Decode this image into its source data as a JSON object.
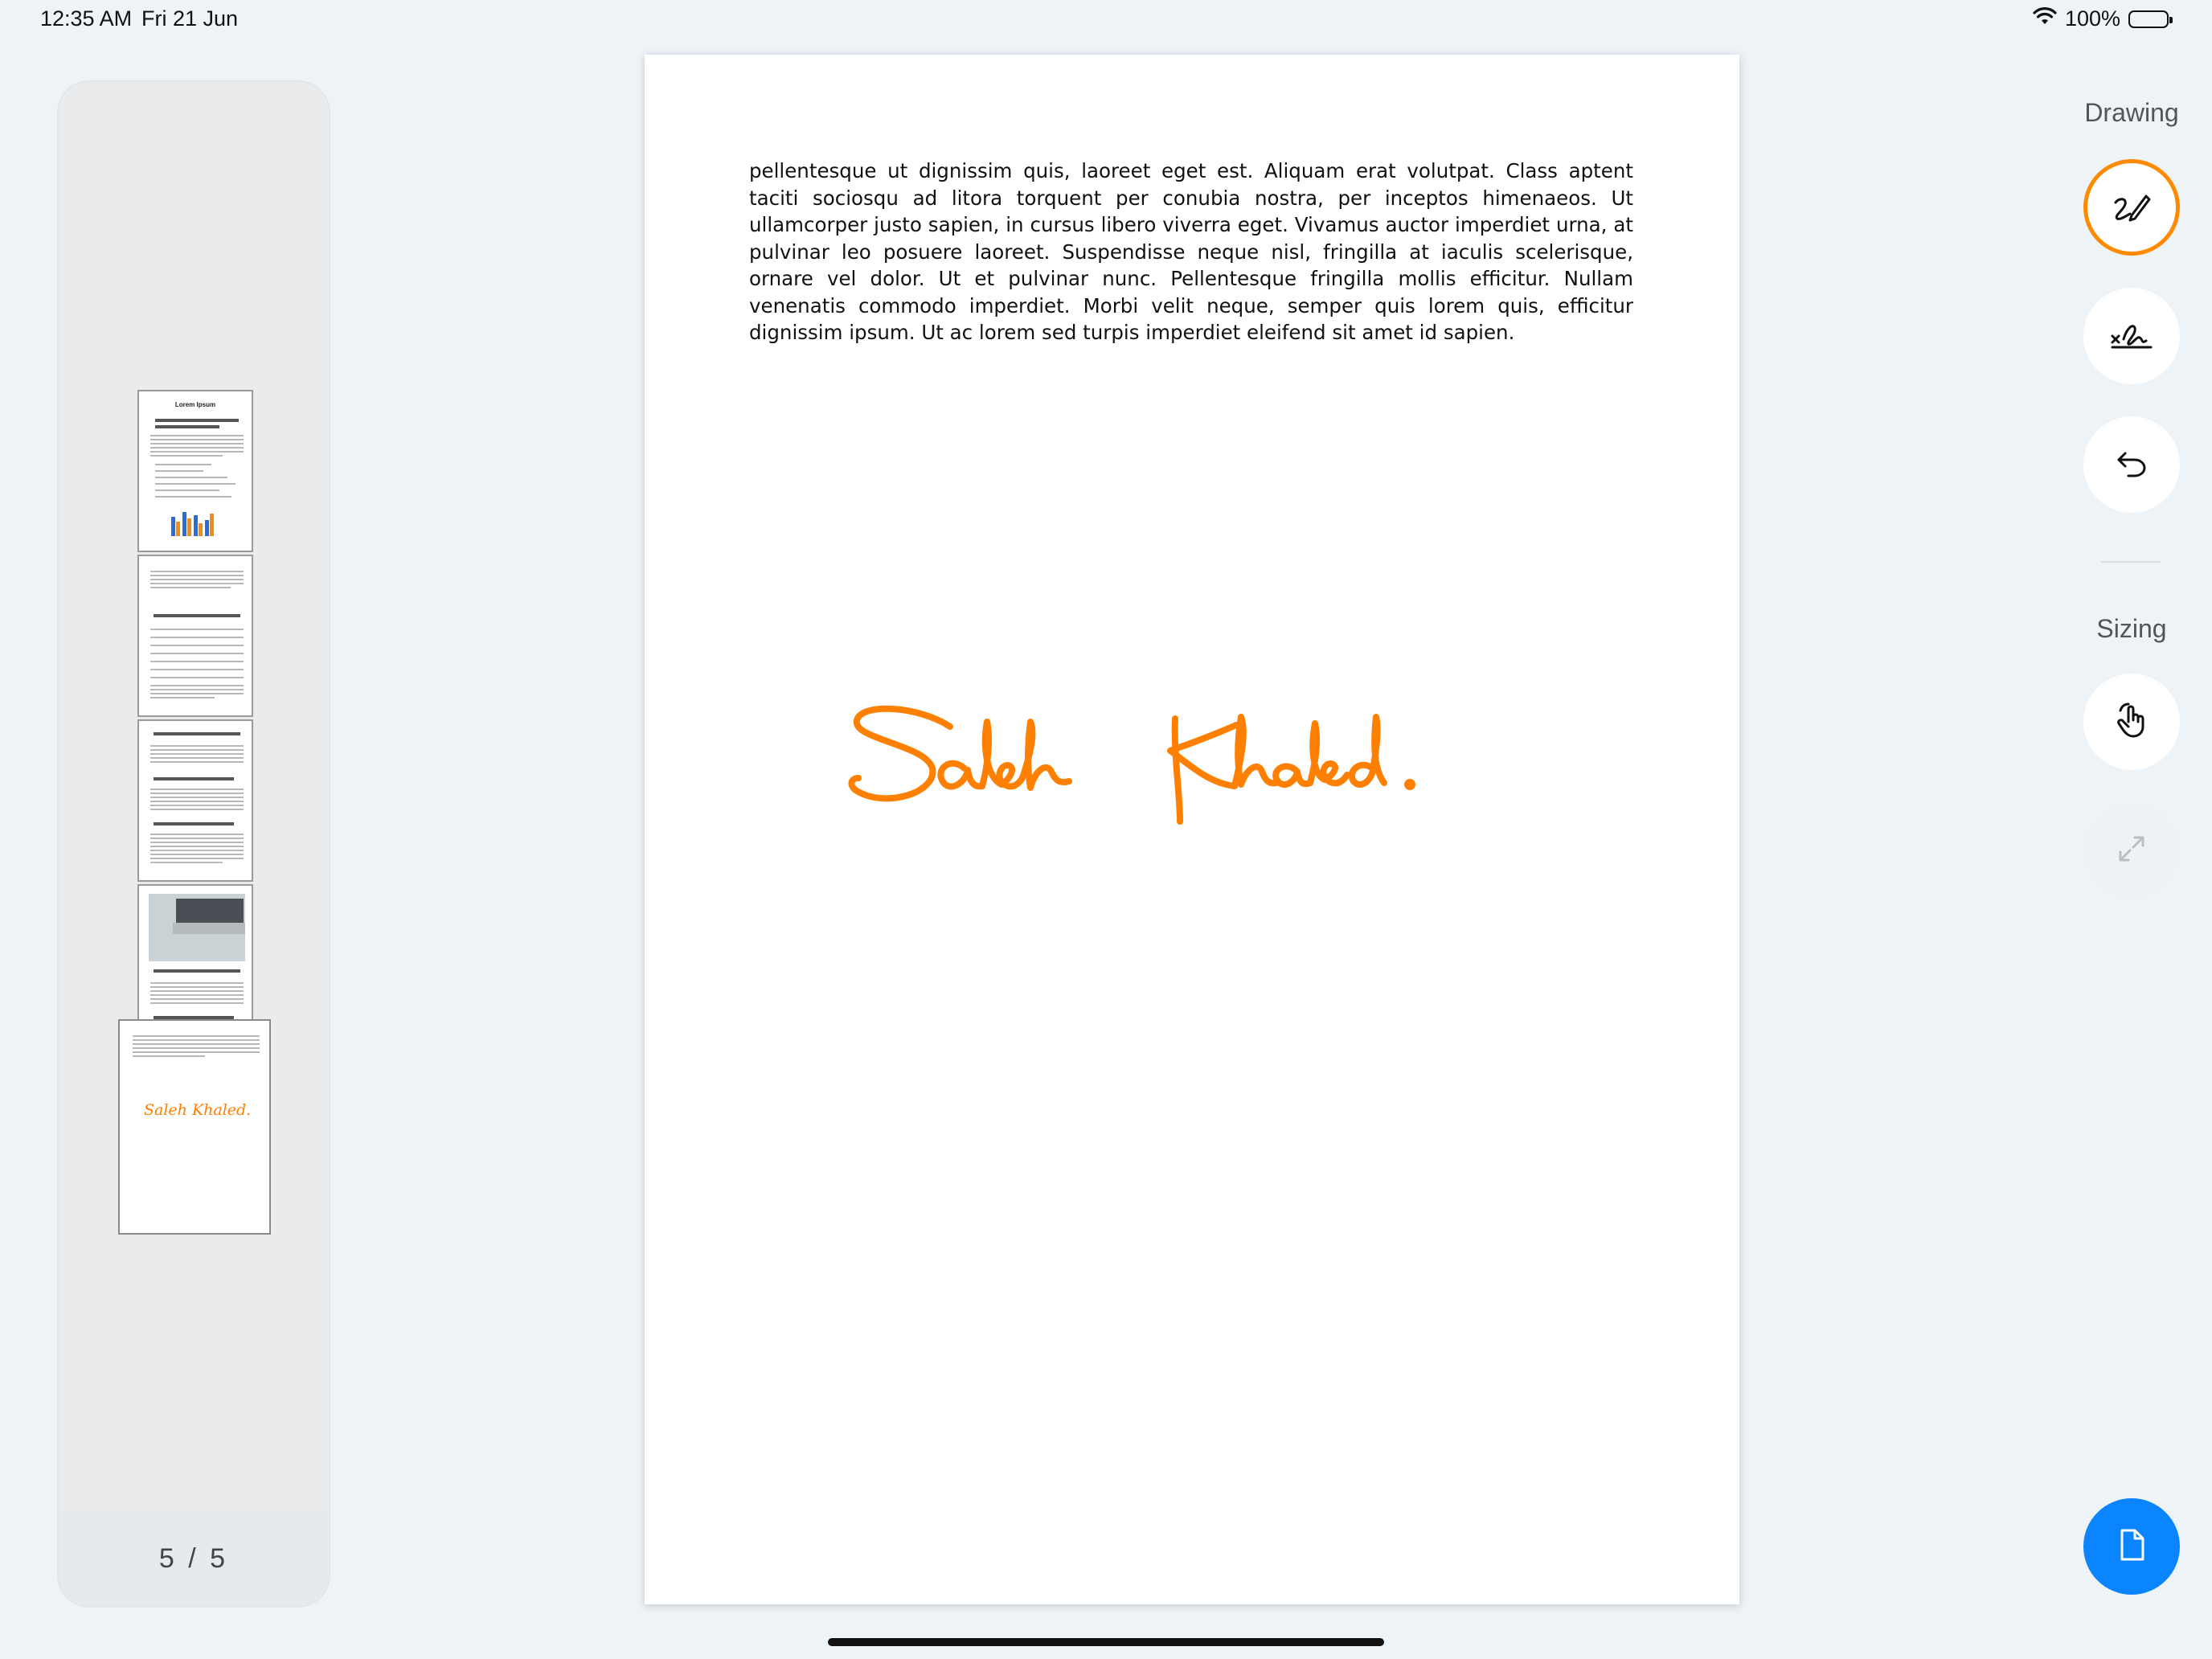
{
  "status_bar": {
    "time": "12:35 AM",
    "date": "Fri 21 Jun",
    "battery_percent": "100%",
    "icons": [
      "wifi-icon",
      "battery-icon"
    ]
  },
  "thumbnails": {
    "pages": [
      {
        "page": 1,
        "title": "Lorem Ipsum"
      },
      {
        "page": 2
      },
      {
        "page": 3
      },
      {
        "page": 4
      },
      {
        "page": 5,
        "selected": true,
        "signature_text": "Saleh Khaled."
      }
    ],
    "page_indicator": "5 / 5"
  },
  "document": {
    "body_text": "pellentesque ut dignissim quis, laoreet eget est. Aliquam erat volutpat. Class aptent taciti sociosqu ad litora torquent per conubia nostra, per inceptos himenaeos. Ut ullamcorper justo sapien, in cursus libero viverra eget. Vivamus auctor imperdiet urna, at pulvinar leo posuere laoreet. Suspendisse neque nisl, fringilla at iaculis scelerisque, ornare vel dolor. Ut et pulvinar nunc. Pellentesque fringilla mollis efficitur. Nullam venenatis commodo imperdiet. Morbi velit neque, semper quis lorem quis, efficitur dignissim ipsum. Ut ac lorem sed turpis imperdiet eleifend sit amet id sapien.",
    "signature_text": "Saleh Khaled.",
    "signature_color": "#ff7f00"
  },
  "toolbar": {
    "drawing_label": "Drawing",
    "sizing_label": "Sizing",
    "tools": [
      {
        "name": "draw-tool",
        "icon": "pen-scribble-icon",
        "active": true
      },
      {
        "name": "signature-tool",
        "icon": "signature-icon",
        "active": false
      },
      {
        "name": "undo",
        "icon": "undo-icon",
        "active": false
      },
      {
        "name": "pan-tool",
        "icon": "hand-pointer-icon",
        "active": false
      },
      {
        "name": "resize-tool",
        "icon": "expand-icon",
        "enabled": false
      }
    ],
    "fab_icon": "document-icon",
    "accent_color": "#ff8a00",
    "fab_color": "#0a84ff"
  }
}
